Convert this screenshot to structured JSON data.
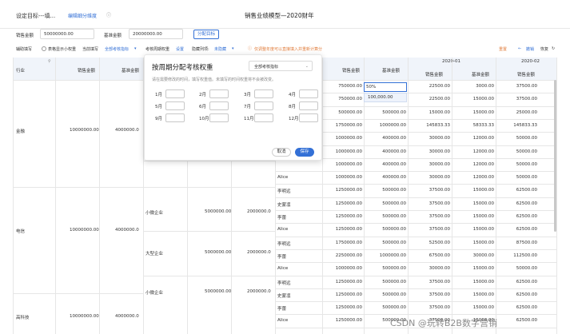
{
  "header": {
    "left_title": "设定目标---填...",
    "tab": "编辑细分维度",
    "center_title": "销售业绩模型—2020财年"
  },
  "filters": {
    "sales_label": "销售金额",
    "sales_value": "50000000.00",
    "base_label": "基准金额",
    "base_value": "20000000.00",
    "assign_button": "分配目标"
  },
  "toolbar": {
    "assist_fill": "辅助填写",
    "show_subtotal": "表格显示小权重",
    "current_fill": "当前填写",
    "metric_select": "全部考核指标",
    "period_weight": "考核周期权重",
    "set": "设置",
    "hidden_cols": "隐藏列项:",
    "hidden_value": "未隐藏",
    "warning": "仅调整年度可以直接填入并重新计算分",
    "reset": "重置",
    "back": "撤销",
    "restore": "恢复"
  },
  "left_headers": {
    "industry": "行业",
    "sales": "销售金额",
    "base": "基准金额"
  },
  "right_headers": {
    "sales": "销售金额",
    "base": "基准金额",
    "m1": "2020-01",
    "m2": "2020-02",
    "m1_sales": "销售金额",
    "m1_base": "基准金额",
    "m2_sales": "销售金额"
  },
  "industries": [
    {
      "name": "金融",
      "sales": "10000000.00",
      "base": "4000000.0"
    },
    {
      "name": "电信",
      "sales": "10000000.00",
      "base": "4000000.0"
    },
    {
      "name": "高科技",
      "sales": "10000000.00",
      "base": "4000000.0"
    }
  ],
  "segments": [
    {
      "name": "小微企业",
      "sales": "5000000.00",
      "base": "2000000.0"
    },
    {
      "name": "大型企业",
      "sales": "5000000.00",
      "base": "2000000.0"
    },
    {
      "name": "小微企业",
      "sales": "5000000.00",
      "base": "2000000.0"
    }
  ],
  "rows": [
    {
      "person": "",
      "sales": "750000.00",
      "base": "",
      "m1s": "22500.00",
      "m1b": "3000.00",
      "m2s": "37500.00"
    },
    {
      "person": "",
      "sales": "750000.00",
      "base": "",
      "m1s": "22500.00",
      "m1b": "15000.00",
      "m2s": "37500.00"
    },
    {
      "person": "",
      "sales": "500000.00",
      "base": "500000.00",
      "m1s": "15000.00",
      "m1b": "15000.00",
      "m2s": "25000.00"
    },
    {
      "person": "",
      "sales": "1750000.00",
      "base": "1000000.00",
      "m1s": "145833.33",
      "m1b": "58333.33",
      "m2s": "145833.33"
    },
    {
      "person": "",
      "sales": "1000000.00",
      "base": "400000.00",
      "m1s": "30000.00",
      "m1b": "12000.00",
      "m2s": "50000.00"
    },
    {
      "person": "",
      "sales": "1000000.00",
      "base": "400000.00",
      "m1s": "30000.00",
      "m1b": "12000.00",
      "m2s": "50000.00"
    },
    {
      "person": "",
      "sales": "1000000.00",
      "base": "400000.00",
      "m1s": "30000.00",
      "m1b": "12000.00",
      "m2s": "50000.00"
    },
    {
      "person": "Alice",
      "sales": "1000000.00",
      "base": "400000.00",
      "m1s": "30000.00",
      "m1b": "12000.00",
      "m2s": "50000.00"
    },
    {
      "person": "李明远",
      "sales": "1250000.00",
      "base": "500000.00",
      "m1s": "37500.00",
      "m1b": "15000.00",
      "m2s": "62500.00"
    },
    {
      "person": "史蒙凛",
      "sales": "1250000.00",
      "base": "500000.00",
      "m1s": "37500.00",
      "m1b": "15000.00",
      "m2s": "62500.00"
    },
    {
      "person": "李蕾",
      "sales": "1250000.00",
      "base": "500000.00",
      "m1s": "37500.00",
      "m1b": "15000.00",
      "m2s": "62500.00"
    },
    {
      "person": "Alice",
      "sales": "1250000.00",
      "base": "500000.00",
      "m1s": "37500.00",
      "m1b": "15000.00",
      "m2s": "62500.00"
    },
    {
      "person": "李明远",
      "sales": "1750000.00",
      "base": "500000.00",
      "m1s": "52500.00",
      "m1b": "15000.00",
      "m2s": "87500.00"
    },
    {
      "person": "李蕾",
      "sales": "2250000.00",
      "base": "1000000.00",
      "m1s": "67500.00",
      "m1b": "30000.00",
      "m2s": "112500.00"
    },
    {
      "person": "Alice",
      "sales": "1000000.00",
      "base": "500000.00",
      "m1s": "30000.00",
      "m1b": "15000.00",
      "m2s": "50000.00"
    },
    {
      "person": "李明远",
      "sales": "1250000.00",
      "base": "500000.00",
      "m1s": "37500.00",
      "m1b": "15000.00",
      "m2s": "62500.00"
    },
    {
      "person": "史蒙凛",
      "sales": "1250000.00",
      "base": "500000.00",
      "m1s": "37500.00",
      "m1b": "15000.00",
      "m2s": "62500.00"
    },
    {
      "person": "李蕾",
      "sales": "1250000.00",
      "base": "500000.00",
      "m1s": "37500.00",
      "m1b": "15000.00",
      "m2s": "62500.00"
    },
    {
      "person": "Alice",
      "sales": "1250000.00",
      "base": "500000.00",
      "m1s": "37500.00",
      "m1b": "15000.00",
      "m2s": "62500.00"
    }
  ],
  "edit_cell": {
    "value": "50%",
    "dropdown": "100,000.00"
  },
  "panel": {
    "title": "按周期分配考核权重",
    "select": "全部考核指标",
    "desc": "请在需要修改的时间，填写权重值。未填写的时间权重将不会被改变。",
    "months": [
      "1月",
      "2月",
      "3月",
      "4月",
      "5月",
      "6月",
      "7月",
      "8月",
      "9月",
      "10月",
      "11月",
      "12月"
    ],
    "cancel": "取消",
    "save": "保存"
  },
  "watermark": "CSDN @玩转B2B数字营销",
  "colors": {
    "accent": "#3370d6",
    "warning": "#e07b39",
    "header_bg": "#f0f4fa"
  }
}
